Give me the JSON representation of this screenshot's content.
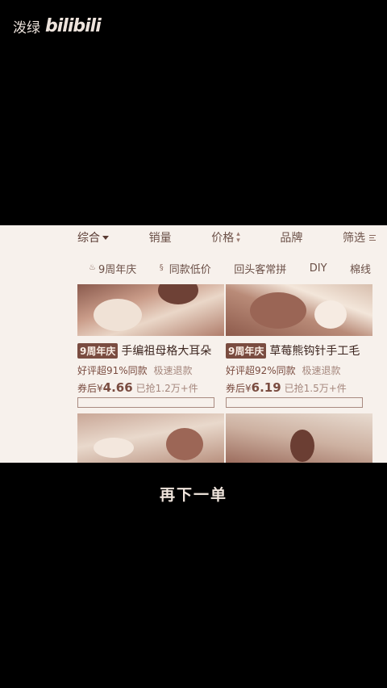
{
  "watermark": {
    "user": "泼绿",
    "logo": "bilibili"
  },
  "sort_bar": {
    "comprehensive": "综合",
    "sales": "销量",
    "price": "价格",
    "brand": "品牌",
    "filter": "筛选"
  },
  "chips": [
    "9周年庆",
    "同款低价",
    "回头客常拼",
    "DIY",
    "棉线"
  ],
  "products": [
    {
      "tag": "9周年庆",
      "title": "手编祖母格大耳朵",
      "rating": "好评超91%同款",
      "refund": "极速退款",
      "price_prefix": "券后¥",
      "price": "4.66",
      "sold": "已抢1.2万+件"
    },
    {
      "tag": "9周年庆",
      "title": "草莓熊钩针手工毛",
      "rating": "好评超92%同款",
      "refund": "极速退款",
      "price_prefix": "券后¥",
      "price": "6.19",
      "sold": "已抢1.5万+件"
    }
  ],
  "subtitle": "再下一单",
  "colors": {
    "accent": "#7a4c40",
    "background": "#000000",
    "screen": "#f7f1ec"
  },
  "icons": [
    "caret-down-icon",
    "sort-arrows-icon",
    "filter-lines-icon",
    "chip-icon"
  ]
}
